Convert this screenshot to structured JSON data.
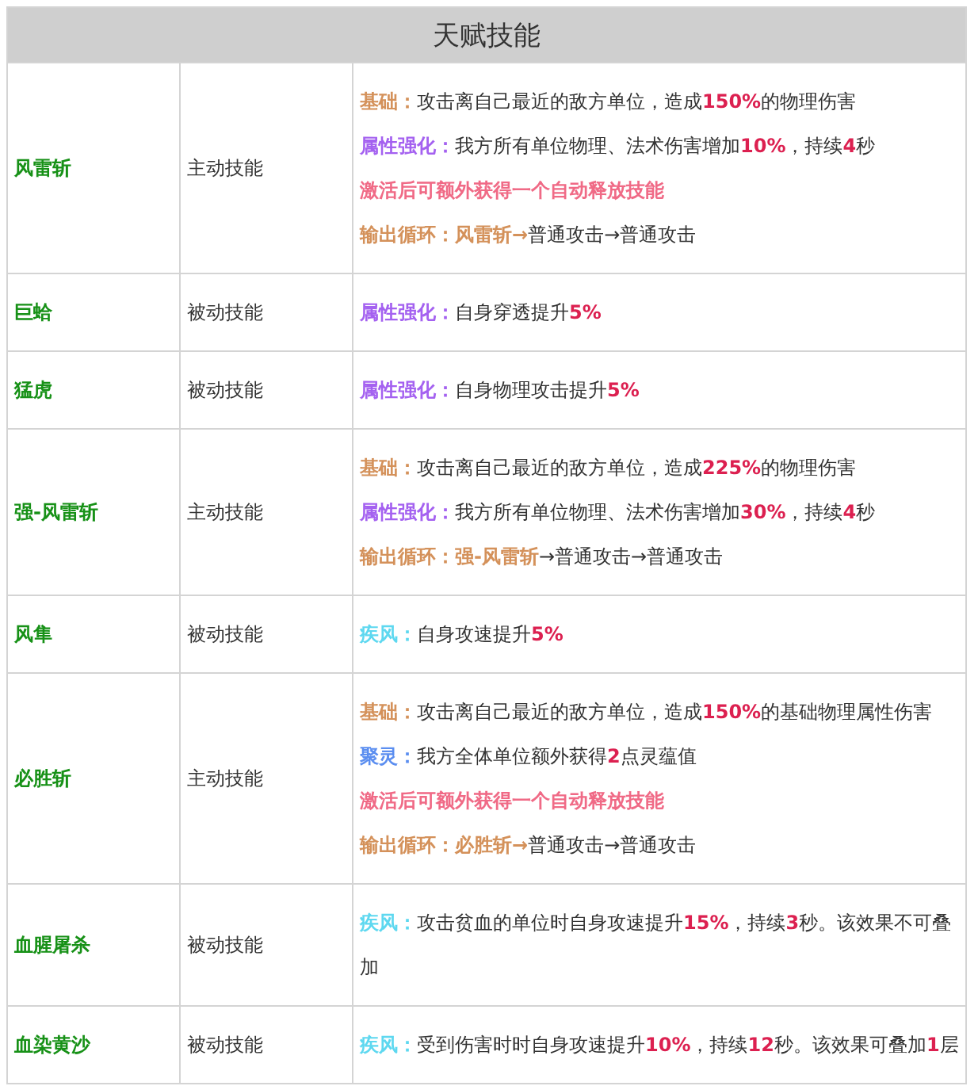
{
  "table": {
    "title": "天赋技能",
    "rows": [
      {
        "name": "风雷斩",
        "type": "主动技能",
        "lines": [
          {
            "kind": "effect",
            "label": "基础：",
            "color": "#d4915a",
            "text": "攻击离自己最近的敌方单位，造成**150%**的物理伤害"
          },
          {
            "kind": "effect",
            "label": "属性强化：",
            "color": "#a461f0",
            "text": "我方所有单位物理、法术伤害增加**10%**，持续**4**秒"
          },
          {
            "kind": "highlight",
            "text": "激活后可额外获得一个自动释放技能"
          },
          {
            "kind": "effect",
            "label": "输出循环：风雷斩→",
            "color": "#d4915a",
            "text": "普通攻击→普通攻击"
          }
        ]
      },
      {
        "name": "巨蛤",
        "type": "被动技能",
        "lines": [
          {
            "kind": "effect",
            "label": "属性强化：",
            "color": "#a461f0",
            "text": "自身穿透提升**5%**"
          }
        ]
      },
      {
        "name": "猛虎",
        "type": "被动技能",
        "lines": [
          {
            "kind": "effect",
            "label": "属性强化：",
            "color": "#a461f0",
            "text": "自身物理攻击提升**5%**"
          }
        ]
      },
      {
        "name": "强-风雷斩",
        "type": "主动技能",
        "lines": [
          {
            "kind": "effect",
            "label": "基础：",
            "color": "#d4915a",
            "text": "攻击离自己最近的敌方单位，造成**225%**的物理伤害"
          },
          {
            "kind": "effect",
            "label": "属性强化：",
            "color": "#a461f0",
            "text": "我方所有单位物理、法术伤害增加**30%**，持续**4**秒"
          },
          {
            "kind": "effect",
            "label": "输出循环：强-风雷斩",
            "color": "#d4915a",
            "text": "→普通攻击→普通攻击"
          }
        ]
      },
      {
        "name": "风隼",
        "type": "被动技能",
        "lines": [
          {
            "kind": "effect",
            "label": "疾风：",
            "color": "#5ed8f0",
            "text": "自身攻速提升**5%**"
          }
        ]
      },
      {
        "name": "必胜斩",
        "type": "主动技能",
        "lines": [
          {
            "kind": "effect",
            "label": "基础：",
            "color": "#d4915a",
            "text": "攻击离自己最近的敌方单位，造成**150%**的基础物理属性伤害"
          },
          {
            "kind": "effect",
            "label": "聚灵：",
            "color": "#5b8ef0",
            "text": "我方全体单位额外获得**2**点灵蕴值"
          },
          {
            "kind": "highlight",
            "text": "激活后可额外获得一个自动释放技能"
          },
          {
            "kind": "effect",
            "label": "输出循环：必胜斩→",
            "color": "#d4915a",
            "text": "普通攻击→普通攻击"
          }
        ]
      },
      {
        "name": "血腥屠杀",
        "type": "被动技能",
        "lines": [
          {
            "kind": "effect",
            "label": "疾风：",
            "color": "#5ed8f0",
            "text": "攻击贫血的单位时自身攻速提升**15%**，持续**3**秒。该效果不可叠加"
          }
        ]
      },
      {
        "name": "血染黄沙",
        "type": "被动技能",
        "lines": [
          {
            "kind": "effect",
            "label": "疾风：",
            "color": "#5ed8f0",
            "text": "受到伤害时时自身攻速提升**10%**，持续**12**秒。该效果可叠加**1**层"
          }
        ]
      }
    ]
  }
}
